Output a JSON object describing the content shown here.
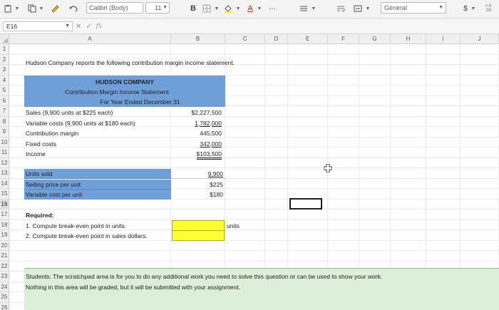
{
  "ribbon": {
    "font_name": "Calibri (Body)",
    "font_size": "11",
    "bold_label": "B",
    "font_color_label": "A",
    "more_label": "···",
    "number_format": "General",
    "currency_label": "$",
    "decimal_label": "+.0\n.00"
  },
  "formula_bar": {
    "name_box": "E16",
    "fx_label": "fx",
    "value": ""
  },
  "columns": [
    "A",
    "B",
    "C",
    "D",
    "E",
    "F",
    "G",
    "H",
    "I",
    "J"
  ],
  "rows": [
    "1",
    "2",
    "3",
    "4",
    "5",
    "6",
    "7",
    "8",
    "9",
    "10",
    "11",
    "12",
    "13",
    "14",
    "15",
    "16",
    "17",
    "18",
    "19",
    "20",
    "21",
    "22",
    "23",
    "24",
    "25",
    "26"
  ],
  "active_row": "16",
  "sheet": {
    "intro": "Hudson Company reports the following contribution margin income statement.",
    "company": "HUDSON COMPANY",
    "statement_title": "Contribution Margin Income Statement",
    "period": "For Year Ended December 31",
    "lines": [
      {
        "label": "Sales (9,900 units at $225 each)",
        "value": "$2,227,500"
      },
      {
        "label": "Variable costs (9,900 units at $180 each)",
        "value": "1,782,000"
      },
      {
        "label": "Contribution margin",
        "value": "445,500"
      },
      {
        "label": "Fixed costs",
        "value": "342,000"
      },
      {
        "label": "Income",
        "value": "$103,500"
      }
    ],
    "unit_info": [
      {
        "label": "Units sold",
        "value": "9,900"
      },
      {
        "label": "Selling price per unit",
        "value": "$225"
      },
      {
        "label": "Variable cost per unit",
        "value": "$180"
      }
    ],
    "required_heading": "Required:",
    "req1": "1. Compute break-even point in units.",
    "req2": "2. Compute break-even point in sales dollars.",
    "req1_unit": "units",
    "req1_answer": "",
    "req2_answer": "",
    "scratch_line1": "Students: The scratchpad area is for you to do any additional work you need to solve this question or can be used to show your work.",
    "scratch_line2": "Nothing in this area will be graded, but it will be submitted with your assignment."
  },
  "colors": {
    "header_blue": "#6f9fd8",
    "answer_yellow": "#ffff33",
    "scratch_green": "#dcefd9"
  }
}
